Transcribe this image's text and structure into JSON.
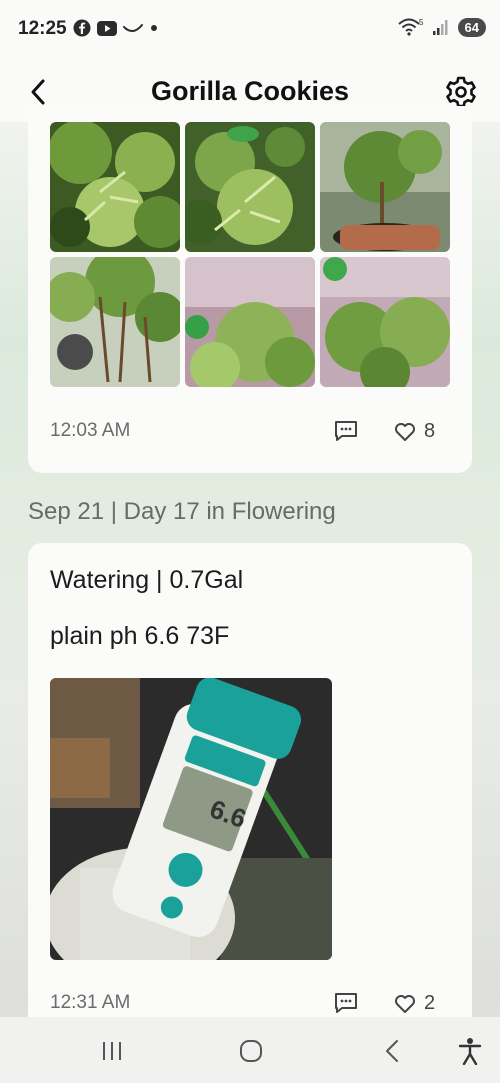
{
  "status_bar": {
    "time": "12:25",
    "left_icons": [
      "facebook-icon",
      "youtube-icon",
      "curve-notification-icon",
      "dot-icon"
    ],
    "right_icons": [
      "wifi-icon",
      "signal-icon"
    ],
    "battery": "64"
  },
  "header": {
    "title": "Gorilla Cookies",
    "back_icon": "chevron-left-icon",
    "settings_icon": "gear-icon"
  },
  "entries": [
    {
      "photos": [
        "plant-photo-1",
        "plant-photo-2",
        "plant-photo-3",
        "plant-photo-4",
        "plant-photo-5",
        "plant-photo-6"
      ],
      "time": "12:03 AM",
      "likes": "8"
    },
    {
      "day_header": "Sep 21 | Day 17 in Flowering",
      "title": "Watering | 0.7Gal",
      "note": "plain ph 6.6 73F",
      "photo": "ph-meter-photo",
      "meter_reading": "6.6",
      "time": "12:31 AM",
      "likes": "2"
    }
  ],
  "nav_bar": {
    "buttons": [
      "recent-apps-icon",
      "home-icon",
      "back-icon",
      "accessibility-icon"
    ]
  }
}
